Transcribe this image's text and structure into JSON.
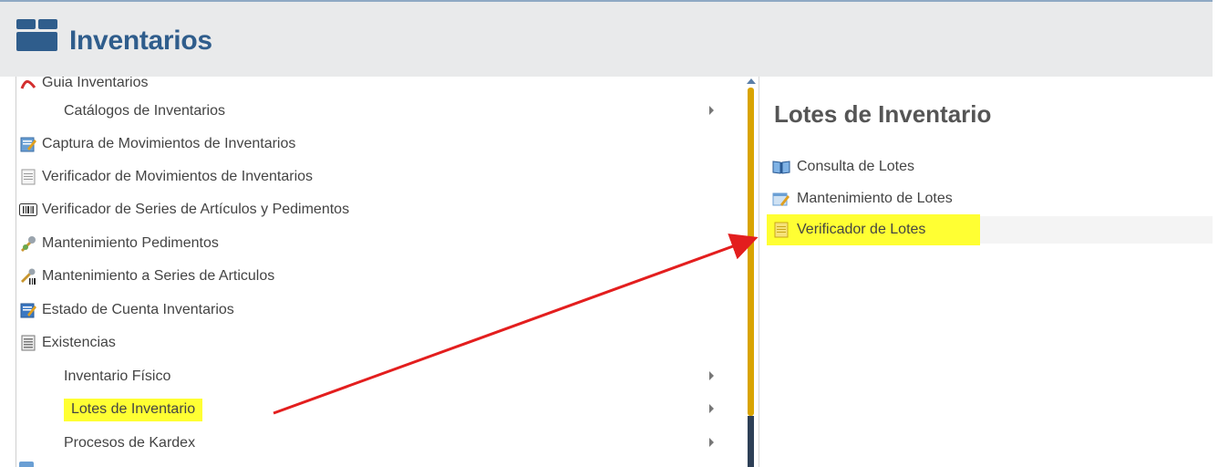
{
  "header": {
    "title": "Inventarios",
    "icon": "box-icon"
  },
  "left_menu": {
    "items": [
      {
        "label": "Guia Inventarios",
        "icon": "pdf-icon",
        "type": "item"
      },
      {
        "label": "Catálogos de Inventarios",
        "icon": "",
        "type": "sub"
      },
      {
        "label": "Captura de Movimientos de Inventarios",
        "icon": "edit-doc-icon",
        "type": "item"
      },
      {
        "label": "Verificador de Movimientos de Inventarios",
        "icon": "document-icon",
        "type": "item"
      },
      {
        "label": "Verificador de Series de Artículos y Pedimentos",
        "icon": "barcode-icon",
        "type": "item"
      },
      {
        "label": "Mantenimiento Pedimentos",
        "icon": "tools-icon",
        "type": "item"
      },
      {
        "label": "Mantenimiento a Series de Articulos",
        "icon": "tools-barcode-icon",
        "type": "item"
      },
      {
        "label": "Estado de Cuenta Inventarios",
        "icon": "edit-doc-icon",
        "type": "item"
      },
      {
        "label": "Existencias",
        "icon": "list-doc-icon",
        "type": "item"
      },
      {
        "label": "Inventario Físico",
        "icon": "",
        "type": "sub"
      },
      {
        "label": "Lotes de Inventario",
        "icon": "",
        "type": "sub",
        "highlighted": true
      },
      {
        "label": "Procesos de Kardex",
        "icon": "",
        "type": "sub"
      }
    ]
  },
  "right_panel": {
    "title": "Lotes de Inventario",
    "items": [
      {
        "label": "Consulta de Lotes",
        "icon": "book-icon"
      },
      {
        "label": "Mantenimiento de Lotes",
        "icon": "edit-table-icon"
      },
      {
        "label": "Verificador de Lotes",
        "icon": "yellow-doc-icon",
        "highlighted": true
      }
    ]
  },
  "colors": {
    "header_bg": "#e9eaeb",
    "title_blue": "#2f5d8c",
    "highlight": "#ffff33",
    "arrow": "#e31e1e",
    "scroll_thumb": "#d9a400"
  }
}
